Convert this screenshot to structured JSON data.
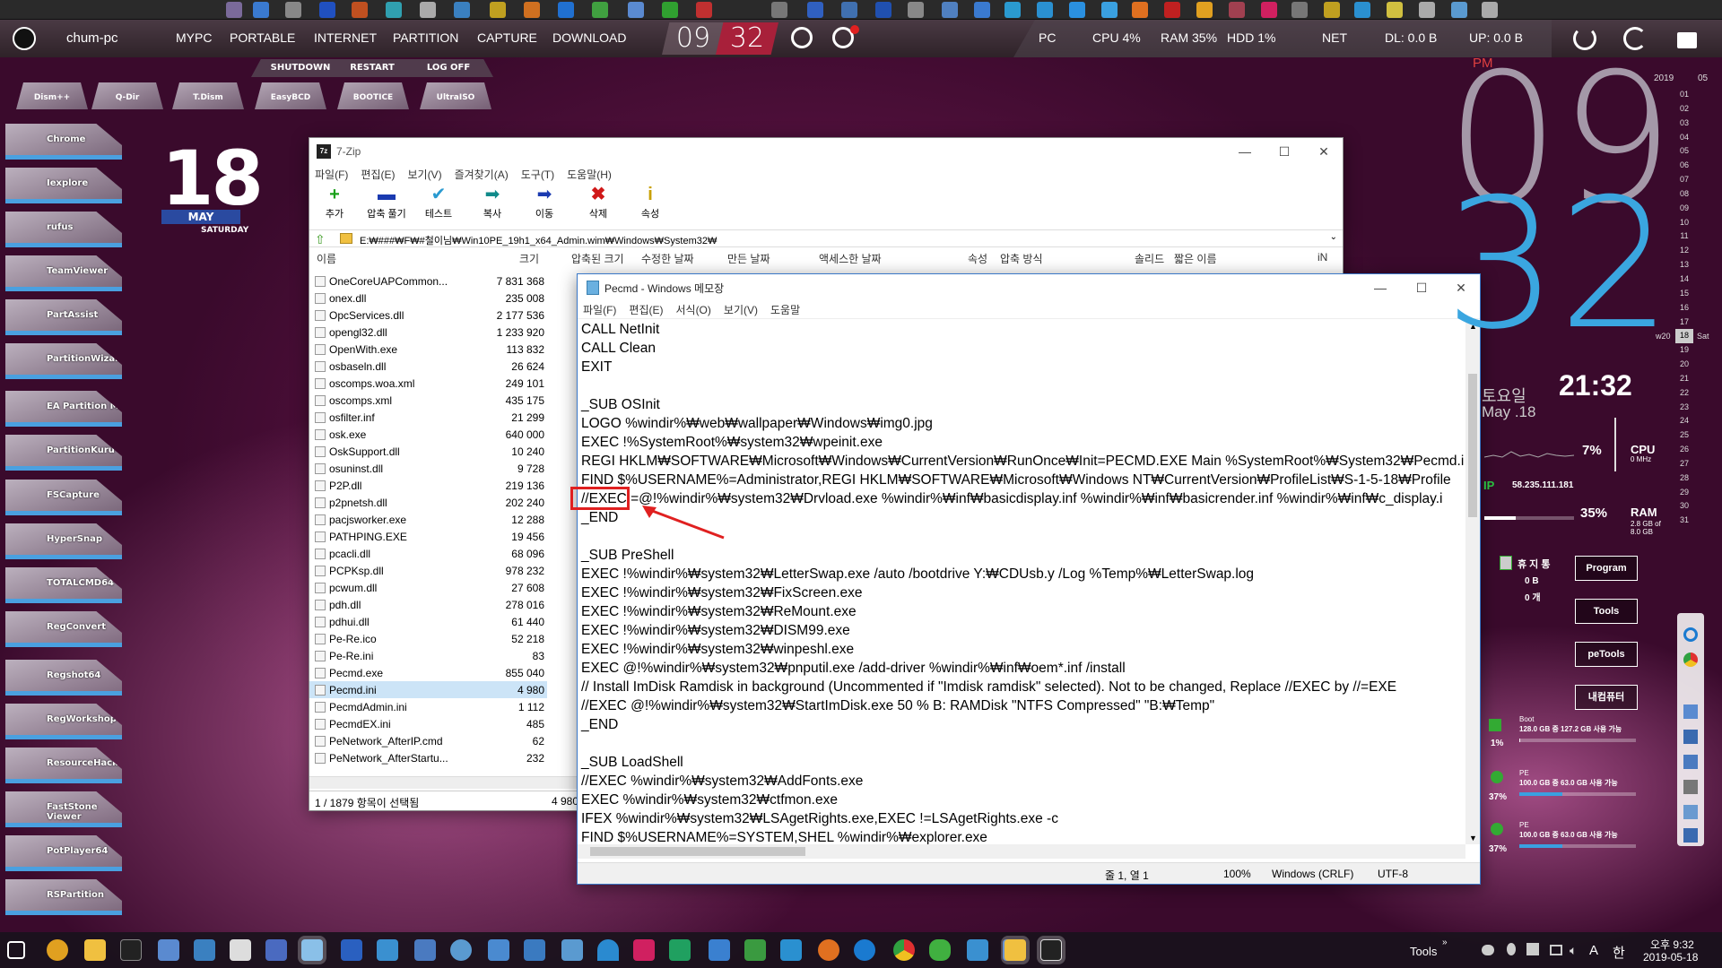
{
  "topbar": {
    "brand": "chum-pc",
    "menu": [
      "MYPC",
      "PORTABLE",
      "INTERNET",
      "PARTITION",
      "CAPTURE",
      "DOWNLOAD"
    ],
    "clock_h": "09",
    "clock_m": "32",
    "pc": "PC",
    "cpu": "CPU  4%",
    "ram": "RAM  35%",
    "hdd": "HDD  1%",
    "net": "NET",
    "dl": "DL: 0.0 B",
    "up": "UP: 0.0 B"
  },
  "subbar": [
    "SHUTDOWN",
    "RESTART",
    "LOG OFF"
  ],
  "quick": [
    "Dism++",
    "Q-Dir",
    "T.Dism",
    "EasyBCD",
    "BOOTICE",
    "UltraISO"
  ],
  "sidebar": [
    "Chrome",
    "Iexplore",
    "rufus",
    "TeamViewer",
    "PartAssist",
    "PartitionWizard",
    "EA Partition M",
    "PartitionKuru",
    "FSCapture",
    "HyperSnap",
    "TOTALCMD64",
    "RegConvert",
    "Regshot64",
    "RegWorkshop",
    "ResourceHacker",
    "FastStone Viewer",
    "PotPlayer64",
    "RSPartition"
  ],
  "calendar": {
    "day": "18",
    "month": "MAY",
    "weekday": "SATURDAY"
  },
  "zip": {
    "title": "7-Zip",
    "menu": [
      "파일(F)",
      "편집(E)",
      "보기(V)",
      "즐겨찾기(A)",
      "도구(T)",
      "도움말(H)"
    ],
    "tools": [
      {
        "icon": "+",
        "label": "추가",
        "color": "#1aa01a"
      },
      {
        "icon": "▬",
        "label": "압축 풀기",
        "color": "#1a3ab0"
      },
      {
        "icon": "✔",
        "label": "테스트",
        "color": "#2a9ad0"
      },
      {
        "icon": "➡",
        "label": "복사",
        "color": "#108a8a"
      },
      {
        "icon": "➡",
        "label": "이동",
        "color": "#1a3ab0"
      },
      {
        "icon": "✖",
        "label": "삭제",
        "color": "#d01818"
      },
      {
        "icon": "i",
        "label": "속성",
        "color": "#c8a000"
      }
    ],
    "path": "E:₩###₩F₩#철이님₩Win10PE_19h1_x64_Admin.wim₩Windows₩System32₩",
    "columns": [
      "이름",
      "크기",
      "압축된 크기",
      "수정한 날짜",
      "만든 날짜",
      "액세스한 날짜",
      "속성",
      "압축 방식",
      "솔리드",
      "짧은 이름",
      "iN"
    ],
    "files": [
      [
        "OneCoreUAPCommon...",
        "7 831 368"
      ],
      [
        "onex.dll",
        "235 008"
      ],
      [
        "OpcServices.dll",
        "2 177 536"
      ],
      [
        "opengl32.dll",
        "1 233 920"
      ],
      [
        "OpenWith.exe",
        "113 832"
      ],
      [
        "osbaseln.dll",
        "26 624"
      ],
      [
        "oscomps.woa.xml",
        "249 101"
      ],
      [
        "oscomps.xml",
        "435 175"
      ],
      [
        "osfilter.inf",
        "21 299"
      ],
      [
        "osk.exe",
        "640 000"
      ],
      [
        "OskSupport.dll",
        "10 240"
      ],
      [
        "osuninst.dll",
        "9 728"
      ],
      [
        "P2P.dll",
        "219 136"
      ],
      [
        "p2pnetsh.dll",
        "202 240"
      ],
      [
        "pacjsworker.exe",
        "12 288"
      ],
      [
        "PATHPING.EXE",
        "19 456"
      ],
      [
        "pcacli.dll",
        "68 096"
      ],
      [
        "PCPKsp.dll",
        "978 232"
      ],
      [
        "pcwum.dll",
        "27 608"
      ],
      [
        "pdh.dll",
        "278 016"
      ],
      [
        "pdhui.dll",
        "61 440"
      ],
      [
        "Pe-Re.ico",
        "52 218"
      ],
      [
        "Pe-Re.ini",
        "83"
      ],
      [
        "Pecmd.exe",
        "855 040"
      ],
      [
        "Pecmd.ini",
        "4 980"
      ],
      [
        "PecmdAdmin.ini",
        "1 112"
      ],
      [
        "PecmdEX.ini",
        "485"
      ],
      [
        "PeNetwork_AfterIP.cmd",
        "62"
      ],
      [
        "PeNetwork_AfterStartu...",
        "232"
      ]
    ],
    "status_left": "1 / 1879 항목이 선택됨",
    "status_right": "4 980"
  },
  "notepad": {
    "title": "Pecmd - Windows 메모장",
    "menu": [
      "파일(F)",
      "편집(E)",
      "서식(O)",
      "보기(V)",
      "도움말"
    ],
    "lines": [
      "CALL NetInit",
      "CALL Clean",
      "EXIT",
      "",
      "_SUB OSInit",
      "LOGO %windir%₩web₩wallpaper₩Windows₩img0.jpg",
      "EXEC !%SystemRoot%₩system32₩wpeinit.exe",
      "REGI HKLM₩SOFTWARE₩Microsoft₩Windows₩CurrentVersion₩RunOnce₩Init=PECMD.EXE Main %SystemRoot%₩System32₩Pecmd.i",
      "FIND $%USERNAME%=Administrator,REGI HKLM₩SOFTWARE₩Microsoft₩Windows NT₩CurrentVersion₩ProfileList₩S-1-5-18₩Profile",
      "//EXEC =@!%windir%₩system32₩Drvload.exe %windir%₩inf₩basicdisplay.inf %windir%₩inf₩basicrender.inf %windir%₩inf₩c_display.i",
      "_END",
      "",
      "_SUB PreShell",
      "EXEC !%windir%₩system32₩LetterSwap.exe /auto /bootdrive Y:₩CDUsb.y /Log %Temp%₩LetterSwap.log",
      "EXEC !%windir%₩system32₩FixScreen.exe",
      "EXEC !%windir%₩system32₩ReMount.exe",
      "EXEC !%windir%₩system32₩DISM99.exe",
      "EXEC !%windir%₩system32₩winpeshl.exe",
      "EXEC @!%windir%₩system32₩pnputil.exe /add-driver %windir%₩inf₩oem*.inf /install",
      "// Install ImDisk Ramdisk in background (Uncommented if \"Imdisk ramdisk\" selected). Not to be changed, Replace //EXEC by //=EXE",
      "//EXEC @!%windir%₩system32₩StartImDisk.exe 50 % B: RAMDisk \"NTFS Compressed\" \"B:₩Temp\"",
      "_END",
      "",
      "_SUB LoadShell",
      "//EXEC %windir%₩system32₩AddFonts.exe",
      "EXEC %windir%₩system32₩ctfmon.exe",
      "IFEX %windir%₩system32₩LSAgetRights.exe,EXEC !=LSAgetRights.exe -c",
      "FIND $%USERNAME%=SYSTEM,SHEL %windir%₩explorer.exe"
    ],
    "status": {
      "pos": "줄 1, 열 1",
      "zoom": "100%",
      "eol": "Windows (CRLF)",
      "enc": "UTF-8"
    }
  },
  "right": {
    "pm": "PM",
    "hour": "09",
    "min": "32",
    "weekday_ko": "토요일",
    "date": "May .18",
    "time": "21:32",
    "cpu_pct": "7%",
    "cpu": "CPU",
    "cpu_mhz": "0 MHz",
    "ip_label": "IP",
    "ip": "58.235.111.181",
    "ram_pct": "35%",
    "ram": "RAM",
    "ram_detail": "2.8 GB of 8.0 GB",
    "year": "2019",
    "month": "05",
    "week": "w20",
    "sat": "Sat",
    "days": [
      "01",
      "02",
      "03",
      "04",
      "05",
      "06",
      "07",
      "08",
      "09",
      "10",
      "11",
      "12",
      "13",
      "14",
      "15",
      "16",
      "17",
      "18",
      "19",
      "20",
      "21",
      "22",
      "23",
      "24",
      "25",
      "26",
      "27",
      "28",
      "29",
      "30",
      "31"
    ],
    "trash_title": "휴 지 통",
    "trash_size": "0 B",
    "trash_count": "0 개",
    "buttons": [
      "Program",
      "Tools",
      "peTools",
      "내컴퓨터"
    ],
    "drives": [
      {
        "name": "Boot",
        "detail": "128.0 GB 중 127.2 GB 사용 가능",
        "pct": "1%"
      },
      {
        "name": "PE",
        "detail": "100.0 GB 중 63.0 GB 사용 가능",
        "pct": "37%"
      },
      {
        "name": "PE",
        "detail": "100.0 GB 중 63.0 GB 사용 가능",
        "pct": "37%"
      }
    ]
  },
  "taskbar": {
    "tools": "Tools",
    "time": "오후 9:32",
    "date": "2019-05-18",
    "lang": "A",
    "ime": "한"
  }
}
